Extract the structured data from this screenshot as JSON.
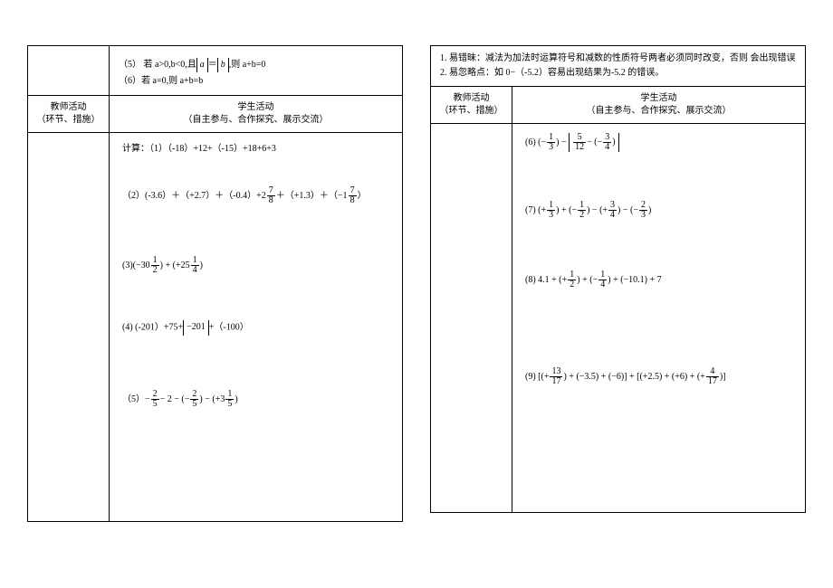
{
  "left": {
    "top": {
      "line5": "（5）  若 a>0,b<0,且|a|＝|b|,则 a+b=0",
      "line6": "（6）若 a=0,则 a+b=b"
    },
    "header": {
      "teacher_title": "教师活动",
      "teacher_sub": "（环节、措施）",
      "student_title": "学生活动",
      "student_sub": "（自主参与、合作探究、展示交流）"
    },
    "problems": {
      "p1_prefix": "计算：（1）（-18）+12+（-15）+18+6+3",
      "p2_prefix": "（2）(-3.6）＋（+2.7）＋（-0.4）+2",
      "p2_mid": "＋（+1.3）＋（−1",
      "p2_suffix": "）",
      "p3_prefix": "(3)(−30",
      "p3_mid": ") + (+25",
      "p3_suffix": ")",
      "p4": "(4)   (-201）+75+|−201|+（-100）",
      "p5_prefix": "（5）−",
      "p5_a": "− 2 − (−",
      "p5_b": ") − (+3",
      "p5_suffix": ")"
    }
  },
  "right": {
    "top": {
      "line1": "1.  易错昧：减法为加法时运算符号和减数的性质符号两者必须同时改变，否则        会出现错误",
      "line2": "2.  易忽略点：如 0−（-5.2）容易出现结果为-5.2 的错误。"
    },
    "header": {
      "teacher_title": "教师活动",
      "teacher_sub": "（环节、措施）",
      "student_title": "学生活动",
      "student_sub": "（自主参与、合作探究、展示交流）"
    },
    "problems": {
      "p6_prefix": "(6)  (−",
      "p6_mid": ") −",
      "p6_inner": "− (−",
      "p6_close": ")",
      "p7_prefix": "(7)    (+",
      "p7_a": ") + (−",
      "p7_b": ") − (+",
      "p7_c": ") − (−",
      "p7_suffix": ")",
      "p8_prefix": "(8)  4.1 + (+",
      "p8_a": ") + (−",
      "p8_b": ") + (−10.1) + 7",
      "p9_prefix": "(9)   [(+",
      "p9_a": ") + (−3.5) + (−6)] + [(+2.5) + (+6) + (+",
      "p9_suffix": ")]"
    }
  }
}
